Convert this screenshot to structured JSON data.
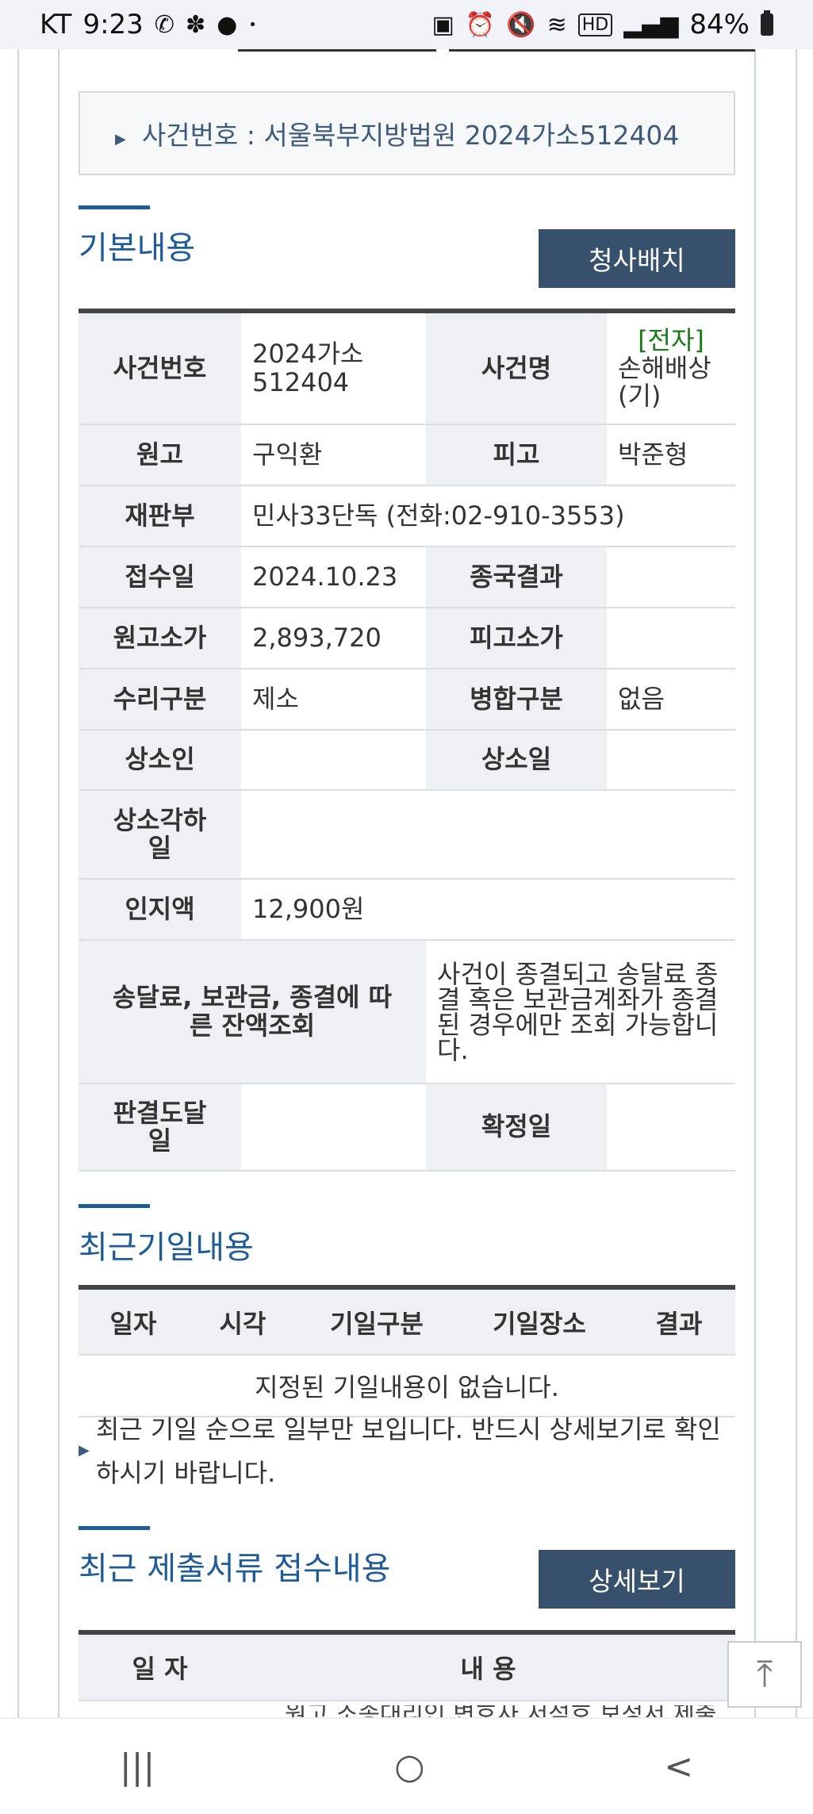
{
  "status_bar": {
    "carrier": "KT",
    "time": "9:23",
    "battery": "84%"
  },
  "case_header": {
    "label": "사건번호 : 서울북부지방법원 2024가소512404"
  },
  "basic": {
    "title": "기본내용",
    "button": "청사배치",
    "rows": {
      "case_no_label": "사건번호",
      "case_no": "2024가소512404",
      "case_name_label": "사건명",
      "case_name_tag": "[전자]",
      "case_name": "손해배상(기)",
      "plaintiff_label": "원고",
      "plaintiff": "구익환",
      "defendant_label": "피고",
      "defendant": "박준형",
      "court_label": "재판부",
      "court": "민사33단독 (전화:02-910-3553)",
      "filed_label": "접수일",
      "filed": "2024.10.23",
      "result_label": "종국결과",
      "result": "",
      "p_amount_label": "원고소가",
      "p_amount": "2,893,720",
      "d_amount_label": "피고소가",
      "d_amount": "",
      "accept_label": "수리구분",
      "accept": "제소",
      "merge_label": "병합구분",
      "merge": "없음",
      "appellant_label": "상소인",
      "appellant": "",
      "appeal_date_label": "상소일",
      "appeal_date": "",
      "appeal_dismiss_label": "상소각하일",
      "appeal_dismiss": "",
      "stamp_label": "인지액",
      "stamp": "12,900원",
      "balance_label": "송달료, 보관금, 종결에 따른 잔액조회",
      "balance": "사건이 종결되고 송달료 종결 혹은 보관금계좌가 종결된 경우에만 조회 가능합니다.",
      "delivery_label": "판결도달일",
      "delivery": "",
      "final_label": "확정일",
      "final": ""
    }
  },
  "dates": {
    "title": "최근기일내용",
    "headers": [
      "일자",
      "시각",
      "기일구분",
      "기일장소",
      "결과"
    ],
    "empty": "지정된 기일내용이 없습니다.",
    "note": "최근 기일 순으로 일부만 보입니다. 반드시 상세보기로 확인하시기 바랍니다."
  },
  "docs": {
    "title": "최근 제출서류 접수내용",
    "button": "상세보기",
    "headers": [
      "일 자",
      "내 용"
    ],
    "cut_text": "원고 소송대리인 변호사 서석호 보정서 제출"
  },
  "nav": {
    "recent": "|||",
    "home": "○",
    "back": "<"
  }
}
